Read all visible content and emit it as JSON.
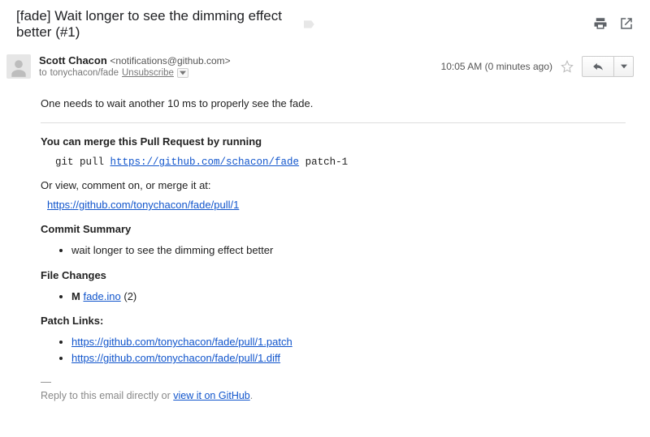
{
  "subject": "[fade] Wait longer to see the dimming effect better (#1)",
  "sender": {
    "name": "Scott Chacon",
    "email": "<notifications@github.com>",
    "recipient_prefix": "to ",
    "recipient": "tonychacon/fade",
    "unsubscribe": "Unsubscribe"
  },
  "meta": {
    "timestamp": "10:05 AM (0 minutes ago)"
  },
  "intro": "One needs to wait another 10 ms to properly see the fade.",
  "merge": {
    "heading": "You can merge this Pull Request by running",
    "cmd_prefix": "git pull ",
    "cmd_url": "https://github.com/schacon/fade",
    "cmd_suffix": " patch-1",
    "or_text": "Or view, comment on, or merge it at:",
    "pr_url": "https://github.com/tonychacon/fade/pull/1"
  },
  "commit": {
    "heading": "Commit Summary",
    "items": [
      "wait longer to see the dimming effect better"
    ]
  },
  "files": {
    "heading": "File Changes",
    "items": [
      {
        "marker": "M",
        "name": "fade.ino",
        "count": "(2)"
      }
    ]
  },
  "patch": {
    "heading": "Patch Links:",
    "links": [
      "https://github.com/tonychacon/fade/pull/1.patch",
      "https://github.com/tonychacon/fade/pull/1.diff"
    ]
  },
  "footer": {
    "dash": "—",
    "text_prefix": "Reply to this email directly or ",
    "link_text": "view it on GitHub",
    "text_suffix": "."
  }
}
